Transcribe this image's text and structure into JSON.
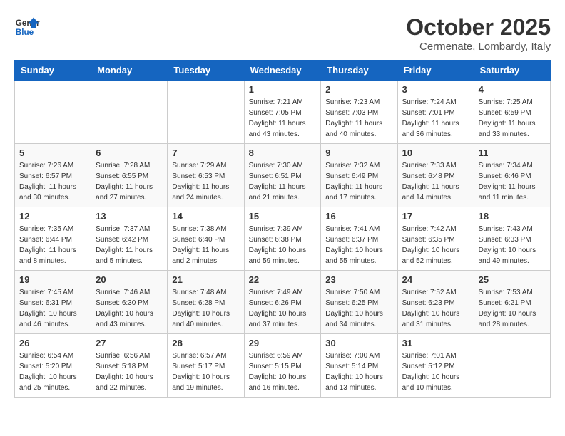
{
  "header": {
    "logo_line1": "General",
    "logo_line2": "Blue",
    "month": "October 2025",
    "location": "Cermenate, Lombardy, Italy"
  },
  "weekdays": [
    "Sunday",
    "Monday",
    "Tuesday",
    "Wednesday",
    "Thursday",
    "Friday",
    "Saturday"
  ],
  "weeks": [
    [
      {
        "day": "",
        "info": ""
      },
      {
        "day": "",
        "info": ""
      },
      {
        "day": "",
        "info": ""
      },
      {
        "day": "1",
        "info": "Sunrise: 7:21 AM\nSunset: 7:05 PM\nDaylight: 11 hours\nand 43 minutes."
      },
      {
        "day": "2",
        "info": "Sunrise: 7:23 AM\nSunset: 7:03 PM\nDaylight: 11 hours\nand 40 minutes."
      },
      {
        "day": "3",
        "info": "Sunrise: 7:24 AM\nSunset: 7:01 PM\nDaylight: 11 hours\nand 36 minutes."
      },
      {
        "day": "4",
        "info": "Sunrise: 7:25 AM\nSunset: 6:59 PM\nDaylight: 11 hours\nand 33 minutes."
      }
    ],
    [
      {
        "day": "5",
        "info": "Sunrise: 7:26 AM\nSunset: 6:57 PM\nDaylight: 11 hours\nand 30 minutes."
      },
      {
        "day": "6",
        "info": "Sunrise: 7:28 AM\nSunset: 6:55 PM\nDaylight: 11 hours\nand 27 minutes."
      },
      {
        "day": "7",
        "info": "Sunrise: 7:29 AM\nSunset: 6:53 PM\nDaylight: 11 hours\nand 24 minutes."
      },
      {
        "day": "8",
        "info": "Sunrise: 7:30 AM\nSunset: 6:51 PM\nDaylight: 11 hours\nand 21 minutes."
      },
      {
        "day": "9",
        "info": "Sunrise: 7:32 AM\nSunset: 6:49 PM\nDaylight: 11 hours\nand 17 minutes."
      },
      {
        "day": "10",
        "info": "Sunrise: 7:33 AM\nSunset: 6:48 PM\nDaylight: 11 hours\nand 14 minutes."
      },
      {
        "day": "11",
        "info": "Sunrise: 7:34 AM\nSunset: 6:46 PM\nDaylight: 11 hours\nand 11 minutes."
      }
    ],
    [
      {
        "day": "12",
        "info": "Sunrise: 7:35 AM\nSunset: 6:44 PM\nDaylight: 11 hours\nand 8 minutes."
      },
      {
        "day": "13",
        "info": "Sunrise: 7:37 AM\nSunset: 6:42 PM\nDaylight: 11 hours\nand 5 minutes."
      },
      {
        "day": "14",
        "info": "Sunrise: 7:38 AM\nSunset: 6:40 PM\nDaylight: 11 hours\nand 2 minutes."
      },
      {
        "day": "15",
        "info": "Sunrise: 7:39 AM\nSunset: 6:38 PM\nDaylight: 10 hours\nand 59 minutes."
      },
      {
        "day": "16",
        "info": "Sunrise: 7:41 AM\nSunset: 6:37 PM\nDaylight: 10 hours\nand 55 minutes."
      },
      {
        "day": "17",
        "info": "Sunrise: 7:42 AM\nSunset: 6:35 PM\nDaylight: 10 hours\nand 52 minutes."
      },
      {
        "day": "18",
        "info": "Sunrise: 7:43 AM\nSunset: 6:33 PM\nDaylight: 10 hours\nand 49 minutes."
      }
    ],
    [
      {
        "day": "19",
        "info": "Sunrise: 7:45 AM\nSunset: 6:31 PM\nDaylight: 10 hours\nand 46 minutes."
      },
      {
        "day": "20",
        "info": "Sunrise: 7:46 AM\nSunset: 6:30 PM\nDaylight: 10 hours\nand 43 minutes."
      },
      {
        "day": "21",
        "info": "Sunrise: 7:48 AM\nSunset: 6:28 PM\nDaylight: 10 hours\nand 40 minutes."
      },
      {
        "day": "22",
        "info": "Sunrise: 7:49 AM\nSunset: 6:26 PM\nDaylight: 10 hours\nand 37 minutes."
      },
      {
        "day": "23",
        "info": "Sunrise: 7:50 AM\nSunset: 6:25 PM\nDaylight: 10 hours\nand 34 minutes."
      },
      {
        "day": "24",
        "info": "Sunrise: 7:52 AM\nSunset: 6:23 PM\nDaylight: 10 hours\nand 31 minutes."
      },
      {
        "day": "25",
        "info": "Sunrise: 7:53 AM\nSunset: 6:21 PM\nDaylight: 10 hours\nand 28 minutes."
      }
    ],
    [
      {
        "day": "26",
        "info": "Sunrise: 6:54 AM\nSunset: 5:20 PM\nDaylight: 10 hours\nand 25 minutes."
      },
      {
        "day": "27",
        "info": "Sunrise: 6:56 AM\nSunset: 5:18 PM\nDaylight: 10 hours\nand 22 minutes."
      },
      {
        "day": "28",
        "info": "Sunrise: 6:57 AM\nSunset: 5:17 PM\nDaylight: 10 hours\nand 19 minutes."
      },
      {
        "day": "29",
        "info": "Sunrise: 6:59 AM\nSunset: 5:15 PM\nDaylight: 10 hours\nand 16 minutes."
      },
      {
        "day": "30",
        "info": "Sunrise: 7:00 AM\nSunset: 5:14 PM\nDaylight: 10 hours\nand 13 minutes."
      },
      {
        "day": "31",
        "info": "Sunrise: 7:01 AM\nSunset: 5:12 PM\nDaylight: 10 hours\nand 10 minutes."
      },
      {
        "day": "",
        "info": ""
      }
    ]
  ]
}
